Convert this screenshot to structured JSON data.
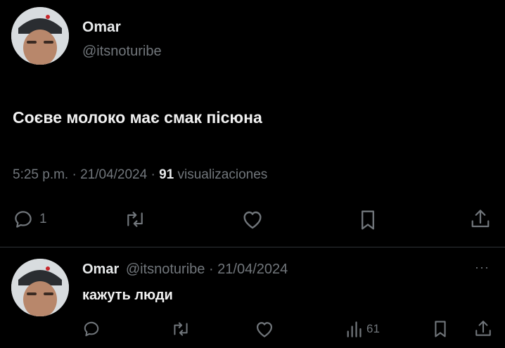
{
  "tweet": {
    "author_name": "Omar",
    "author_handle": "@itsnoturibe",
    "text": "Соєве молоко має смак пісюна",
    "time": "5:25 p.m. · 21/04/2024 · ",
    "views_count": "91",
    "views_label": " visualizaciones",
    "reply_count": "1",
    "icons": [
      "reply-icon",
      "retweet-icon",
      "like-icon",
      "bookmark-icon",
      "share-icon"
    ]
  },
  "reply": {
    "author_name": "Omar",
    "author_handle": "@itsnoturibe",
    "date": " · 21/04/2024",
    "text": "кажуть люди",
    "views_count": "61",
    "more": "···",
    "icons": [
      "reply-icon",
      "retweet-icon",
      "like-icon",
      "views-icon",
      "bookmark-icon",
      "share-icon"
    ]
  },
  "colors": {
    "background": "#000000",
    "text": "#e7e9ea",
    "muted": "#71767b"
  }
}
